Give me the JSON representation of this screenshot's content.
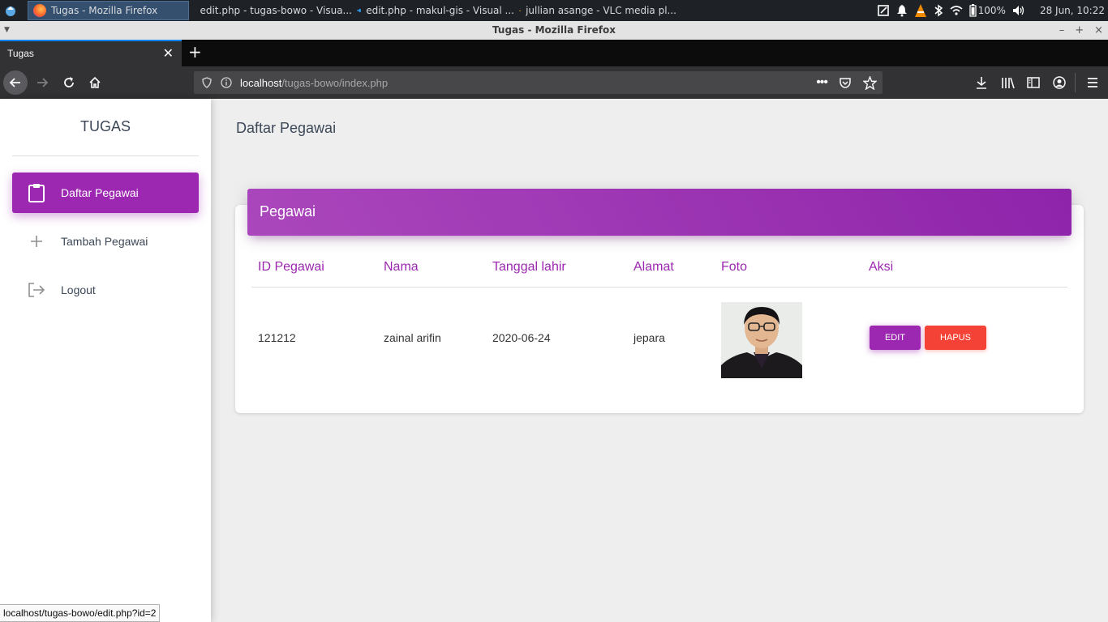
{
  "taskbar": {
    "tasks": [
      {
        "label": "Tugas - Mozilla Firefox",
        "icon": "firefox-icon"
      },
      {
        "label": "edit.php - tugas-bowo - Visua...",
        "icon": "vscode-icon"
      },
      {
        "label": "edit.php - makul-gis - Visual ...",
        "icon": "vscode-icon"
      },
      {
        "label": "jullian asange - VLC media pl...",
        "icon": "vlc-icon"
      }
    ],
    "battery": "100%",
    "datetime": "28 Jun, 10:22"
  },
  "window": {
    "title": "Tugas - Mozilla Firefox"
  },
  "browser": {
    "tab_title": "Tugas",
    "url_host": "localhost",
    "url_path": "/tugas-bowo/index.php",
    "status_url": "localhost/tugas-bowo/edit.php?id=2"
  },
  "sidebar": {
    "brand": "TUGAS",
    "items": [
      {
        "label": "Daftar Pegawai",
        "icon": "clipboard-icon",
        "active": true
      },
      {
        "label": "Tambah Pegawai",
        "icon": "plus-icon",
        "active": false
      },
      {
        "label": "Logout",
        "icon": "logout-icon",
        "active": false
      }
    ]
  },
  "main": {
    "title": "Daftar Pegawai",
    "card_title": "Pegawai",
    "columns": [
      "ID Pegawai",
      "Nama",
      "Tanggal lahir",
      "Alamat",
      "Foto",
      "Aksi"
    ],
    "rows": [
      {
        "id": "121212",
        "nama": "zainal arifin",
        "tanggal": "2020-06-24",
        "alamat": "jepara",
        "edit": "EDIT",
        "hapus": "HAPUS"
      }
    ]
  },
  "colors": {
    "accent": "#9c27b0",
    "danger": "#f44336"
  }
}
